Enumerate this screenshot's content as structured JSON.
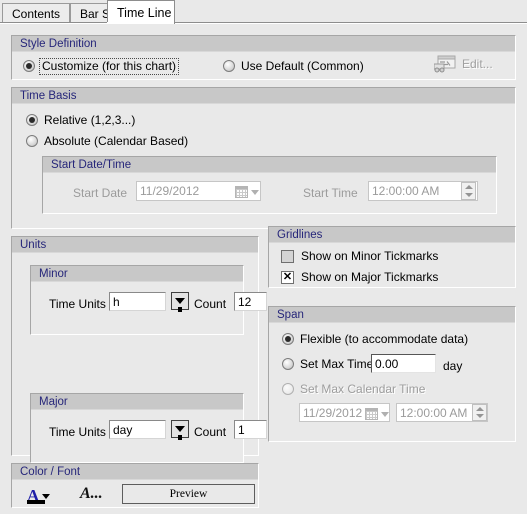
{
  "tabs": [
    {
      "label": "Contents",
      "selected": false
    },
    {
      "label": "Bar Style",
      "selected": false
    },
    {
      "label": "Time Line",
      "selected": true
    }
  ],
  "style_definition": {
    "caption": "Style Definition",
    "customize_label": "Customize (for this chart)",
    "use_default_label": "Use Default (Common)",
    "edit_label": "Edit...",
    "edit_icon": "chart-truck-icon"
  },
  "time_basis": {
    "caption": "Time Basis",
    "relative_label": "Relative (1,2,3...)",
    "absolute_label": "Absolute (Calendar Based)",
    "start_group": {
      "caption": "Start Date/Time",
      "start_date_label": "Start Date",
      "start_date_value": "11/29/2012",
      "start_time_label": "Start Time",
      "start_time_value": "12:00:00 AM",
      "calendar_icon": "calendar-icon",
      "dropdown_icon": "chevron-down-icon",
      "spinner_icon": "spinner-updown-icon"
    }
  },
  "units": {
    "caption": "Units",
    "minor": {
      "caption": "Minor",
      "time_units_label": "Time Units",
      "time_units_value": "h",
      "dropdown_icon": "dropdown-arrow-icon",
      "count_label": "Count",
      "count_value": "12"
    },
    "major": {
      "caption": "Major",
      "time_units_label": "Time Units",
      "time_units_value": "day",
      "dropdown_icon": "dropdown-arrow-icon",
      "count_label": "Count",
      "count_value": "1"
    }
  },
  "gridlines": {
    "caption": "Gridlines",
    "minor_label": "Show on Minor Tickmarks",
    "minor_checked": false,
    "major_label": "Show on Major Tickmarks",
    "major_checked": true
  },
  "span": {
    "caption": "Span",
    "flexible_label": "Flexible (to accommodate data)",
    "set_max_time_label": "Set Max Time",
    "set_max_time_value": "0.00",
    "set_max_time_unit": "day",
    "set_max_calendar_label": "Set Max Calendar Time",
    "calendar_date_value": "11/29/2012",
    "calendar_time_value": "12:00:00 AM",
    "calendar_icon": "calendar-icon",
    "dropdown_icon": "chevron-down-icon",
    "spinner_icon": "spinner-updown-icon"
  },
  "color_font": {
    "caption": "Color / Font",
    "color_button_glyph": "A",
    "color_button_icon": "text-color-icon",
    "font_button_glyph": "A...",
    "font_button_icon": "font-icon",
    "preview_label": "Preview"
  },
  "colors": {
    "group_caption_text": "#26267a",
    "group_caption_bg": "#c8c8c8",
    "window_bg": "#e9e9e9",
    "disabled_text": "#9b9b9b",
    "color_button_accent": "#1e1ea8"
  }
}
